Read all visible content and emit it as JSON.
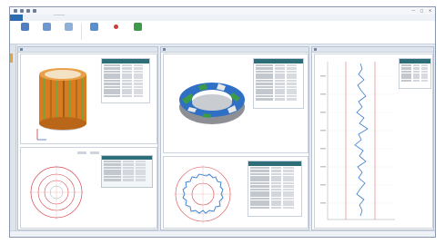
{
  "title_bar": {
    "text": "",
    "quick_access_icons": [
      "save-icon",
      "undo-icon",
      "redo-icon",
      "open-icon"
    ],
    "window_controls": [
      "—",
      "□",
      "✕"
    ]
  },
  "menu": {
    "file_label": "",
    "tabs": [
      "",
      "",
      "",
      "",
      "",
      "",
      ""
    ]
  },
  "ribbon": {
    "group1": [
      {
        "label": "",
        "icon": "document-icon",
        "color": "#4f7fc1"
      },
      {
        "label": "",
        "icon": "copy-icon",
        "color": "#6d97cf"
      },
      {
        "label": "",
        "icon": "paste-icon",
        "color": "#8fb0d9"
      }
    ],
    "group2": [
      {
        "label": "",
        "icon": "measure-icon",
        "color": "#5a8fcf"
      },
      {
        "label": "",
        "icon": "red-marker-icon",
        "color": "#d23a3a"
      },
      {
        "label": "",
        "icon": "green-run-icon",
        "color": "#3c9a4a"
      }
    ]
  },
  "panes": {
    "left": {
      "title": ""
    },
    "middle": {
      "title": ""
    },
    "right": {
      "title": ""
    }
  },
  "colors": {
    "accent": "#2b6cb0",
    "table_header": "#2d6e79",
    "cylinder_orange": "#d97b20",
    "cylinder_green": "#7ba33a",
    "ring_blue": "#2f6fc4",
    "ring_green": "#3c9a4a",
    "polar_red": "#d9474c",
    "trace_blue": "#3a7ed0",
    "limit_red": "#e05555"
  },
  "status": {
    "text": ""
  }
}
